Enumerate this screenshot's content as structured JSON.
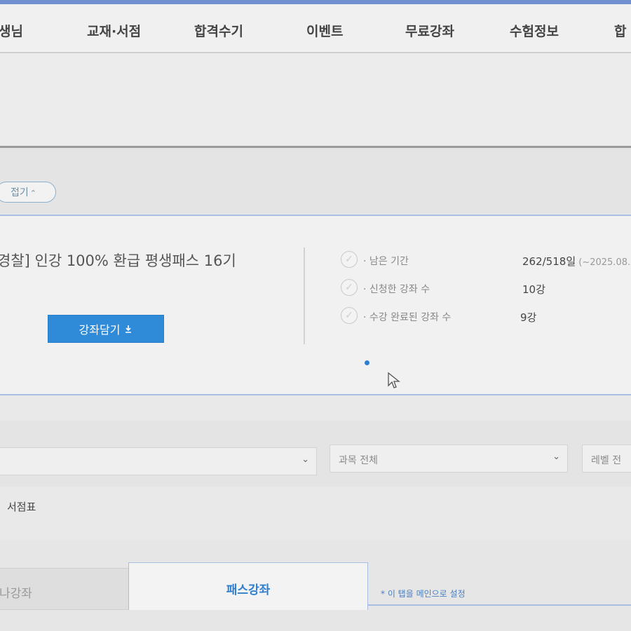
{
  "nav": {
    "items": [
      "생님",
      "교재·서점",
      "합격수기",
      "이벤트",
      "무료강좌",
      "수험정보",
      "합"
    ]
  },
  "fold_button": {
    "label": "접기",
    "icon": "chevron-up-icon"
  },
  "course": {
    "title": "경찰] 인강 100% 환급 평생패스 16기",
    "add_button_label": "강좌담기",
    "add_button_icon": "download-icon",
    "stats": [
      {
        "label": "· 남은 기간",
        "value": "262/518일",
        "sub": " (~2025.08."
      },
      {
        "label": "· 신청한 강좌 수",
        "value": "10강",
        "sub": ""
      },
      {
        "label": "· 수강 완료된 강좌 수",
        "value": "9강",
        "sub": ""
      }
    ]
  },
  "filters": {
    "first_select": "",
    "subject_select": "과목 전체",
    "level_select": "레벨 전"
  },
  "bookmark_label": "서점표",
  "tabs": {
    "inactive_label": "나강좌",
    "active_label": "패스강좌",
    "main_note": "* 이 탭을 메인으로 설정"
  },
  "colors": {
    "accent": "#2f8ad8",
    "border_blue": "#a7bde2",
    "active_tab_text": "#2f7fd0"
  }
}
